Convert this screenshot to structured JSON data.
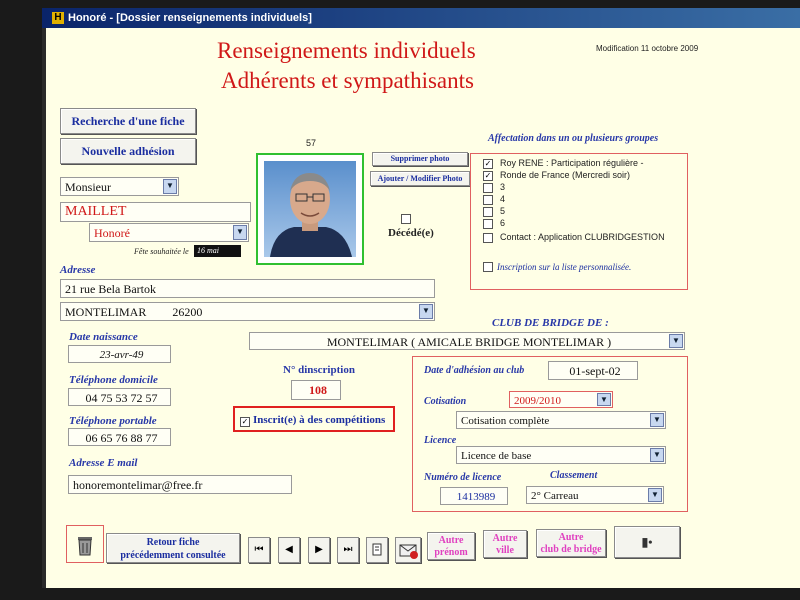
{
  "window": {
    "title": "Honoré - [Dossier renseignements individuels]",
    "app_icon": "H"
  },
  "header": {
    "line1": "Renseignements  individuels",
    "line2": "Adhérents  et sympathisants",
    "modification": "Modification 11 octobre 2009"
  },
  "buttons": {
    "search": "Recherche d'une fiche",
    "new_member": "Nouvelle adhésion",
    "delete_photo": "Supprimer photo",
    "add_photo": "Ajouter / Modifier Photo",
    "back_line1": "Retour  fiche",
    "back_line2": "précédemment consultée",
    "other_first_line1": "Autre",
    "other_first_line2": "prénom",
    "other_city_line1": "Autre",
    "other_city_line2": "ville",
    "other_club_line1": "Autre",
    "other_club_line2": "club de bridge"
  },
  "record_number": "57",
  "person": {
    "civility": "Monsieur",
    "last_name": "MAILLET",
    "first_name": "Honoré",
    "birthday_wish_label": "Fête souhaitée le",
    "birthday_wish_value": "16 mai",
    "deceased_label": "Décédé(e)"
  },
  "address": {
    "label": "Adresse",
    "street": "21 rue Bela Bartok",
    "city": "MONTELIMAR",
    "postcode": "26200"
  },
  "birth": {
    "label": "Date naissance",
    "value": "23-avr-49"
  },
  "phone_home": {
    "label": "Téléphone domicile",
    "value": "04 75 53 72 57"
  },
  "phone_mobile": {
    "label": "Téléphone portable",
    "value": "06 65 76 88 77"
  },
  "email": {
    "label": "Adresse E mail",
    "value": "honoremontelimar@free.fr"
  },
  "registration": {
    "label": "N° dinscription",
    "value": "108"
  },
  "competitions": {
    "label": "Inscrit(e) à des compétitions",
    "checked": true
  },
  "groups": {
    "title": "Affectation dans un ou plusieurs groupes",
    "items": [
      {
        "label": "Roy RENE : Participation régulière -",
        "checked": true
      },
      {
        "label": "Ronde de France (Mercredi soir)",
        "checked": true
      },
      {
        "label": "3",
        "checked": false
      },
      {
        "label": "4",
        "checked": false
      },
      {
        "label": "5",
        "checked": false
      },
      {
        "label": "6",
        "checked": false
      },
      {
        "label": "Contact : Application CLUBRIDGESTION",
        "checked": false
      }
    ],
    "custom_list": "Inscription sur la liste personnalisée."
  },
  "club": {
    "label": "CLUB DE BRIDGE DE :",
    "value": "MONTELIMAR  ( AMICALE BRIDGE MONTELIMAR )",
    "join_date_label": "Date d'adhésion au club",
    "join_date": "01-sept-02",
    "fee_label": "Cotisation",
    "fee_season": "2009/2010",
    "fee_type": "Cotisation complète",
    "license_label": "Licence",
    "license_type": "Licence de base",
    "license_number_label": "Numéro de licence",
    "license_number": "1413989",
    "ranking_label": "Classement",
    "ranking": "2° Carreau"
  },
  "nav": {
    "first": "⏮",
    "prev": "◀",
    "next": "▶",
    "last": "⏭"
  },
  "colors": {
    "heading": "#d01818",
    "label_blue": "#2838a8",
    "title_bar": "#0a246a",
    "form_bg": "#ffffe6"
  }
}
